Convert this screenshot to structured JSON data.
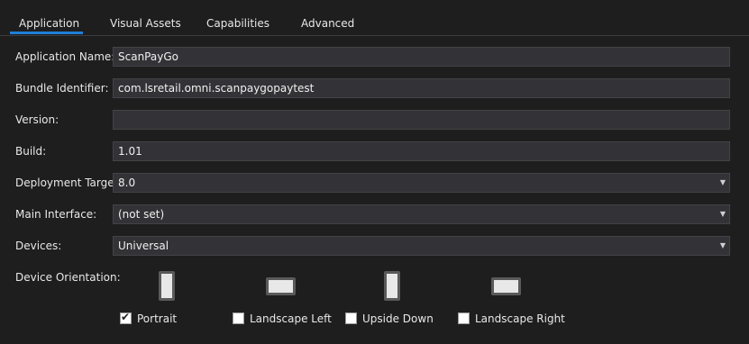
{
  "tabs": [
    {
      "label": "Application",
      "active": true
    },
    {
      "label": "Visual Assets",
      "active": false
    },
    {
      "label": "Capabilities",
      "active": false
    },
    {
      "label": "Advanced",
      "active": false
    }
  ],
  "form": {
    "app_name": {
      "label": "Application Name:",
      "value": "ScanPayGo"
    },
    "bundle_id": {
      "label": "Bundle Identifier:",
      "value": "com.lsretail.omni.scanpaygopaytest"
    },
    "version": {
      "label": "Version:",
      "value": ""
    },
    "build": {
      "label": "Build:",
      "value": "1.01"
    },
    "deployment_target": {
      "label": "Deployment Target:",
      "value": "8.0"
    },
    "main_interface": {
      "label": "Main Interface:",
      "value": "(not set)"
    },
    "devices": {
      "label": "Devices:",
      "value": "Universal"
    }
  },
  "orientation": {
    "label": "Device Orientation:",
    "options": [
      {
        "label": "Portrait",
        "checked": true,
        "icon": "portrait-icon"
      },
      {
        "label": "Landscape Left",
        "checked": false,
        "icon": "landscape-left-icon"
      },
      {
        "label": "Upside Down",
        "checked": false,
        "icon": "upside-down-icon"
      },
      {
        "label": "Landscape Right",
        "checked": false,
        "icon": "landscape-right-icon"
      }
    ]
  },
  "icons": {
    "dropdown": "chevron-down-icon",
    "check": "✔",
    "arrow": "▼"
  },
  "colors": {
    "background": "#1e1e1e",
    "accent": "#1f7fd6",
    "field": "#333337"
  }
}
